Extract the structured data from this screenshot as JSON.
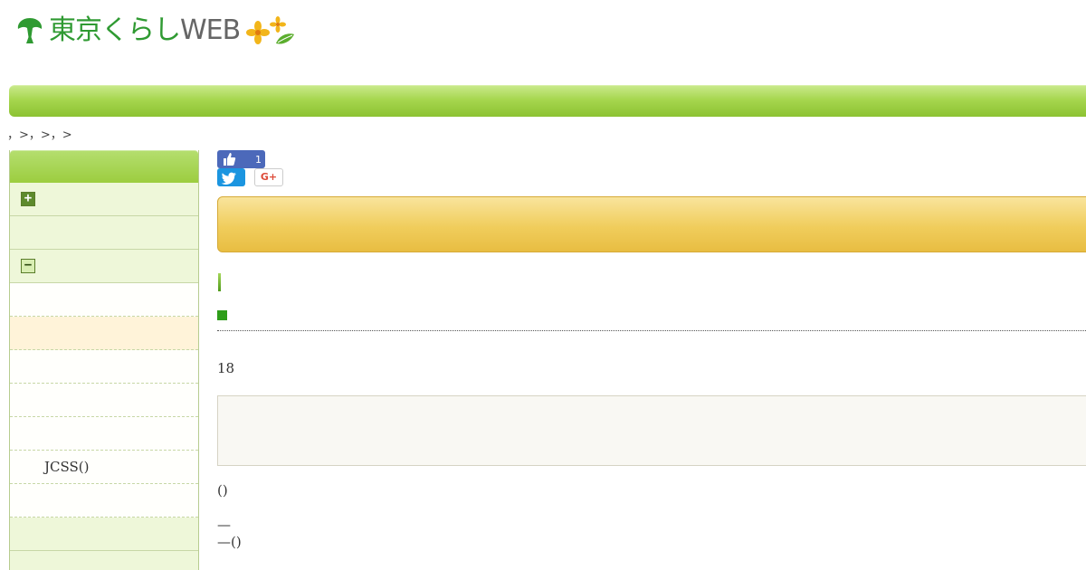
{
  "header": {
    "logo_text_green": "東京くらし",
    "logo_text_gray": "WEB",
    "colors": {
      "brand_green": "#2f9a32",
      "nav_green": "#a6d64e",
      "title_gold": "#f0cd5c"
    }
  },
  "breadcrumb": {
    "text": "，>，>，>"
  },
  "sidebar": {
    "items": [
      {
        "label": "",
        "kind": "top",
        "icon": "plus"
      },
      {
        "label": "",
        "kind": "top"
      },
      {
        "label": "",
        "kind": "top",
        "icon": "minus"
      },
      {
        "label": "",
        "kind": "sub"
      },
      {
        "label": "",
        "kind": "active"
      },
      {
        "label": "",
        "kind": "sub"
      },
      {
        "label": "",
        "kind": "sub"
      },
      {
        "label": "",
        "kind": "sub"
      },
      {
        "label": "JCSS()",
        "kind": "sub"
      },
      {
        "label": "",
        "kind": "sub"
      },
      {
        "label": "",
        "kind": "top"
      },
      {
        "label": "",
        "kind": "top"
      }
    ]
  },
  "social": {
    "like_count": "1",
    "gplus_label": "G+"
  },
  "content": {
    "number_text": "18",
    "para1": "()",
    "para2": "—",
    "para3": "—()"
  }
}
